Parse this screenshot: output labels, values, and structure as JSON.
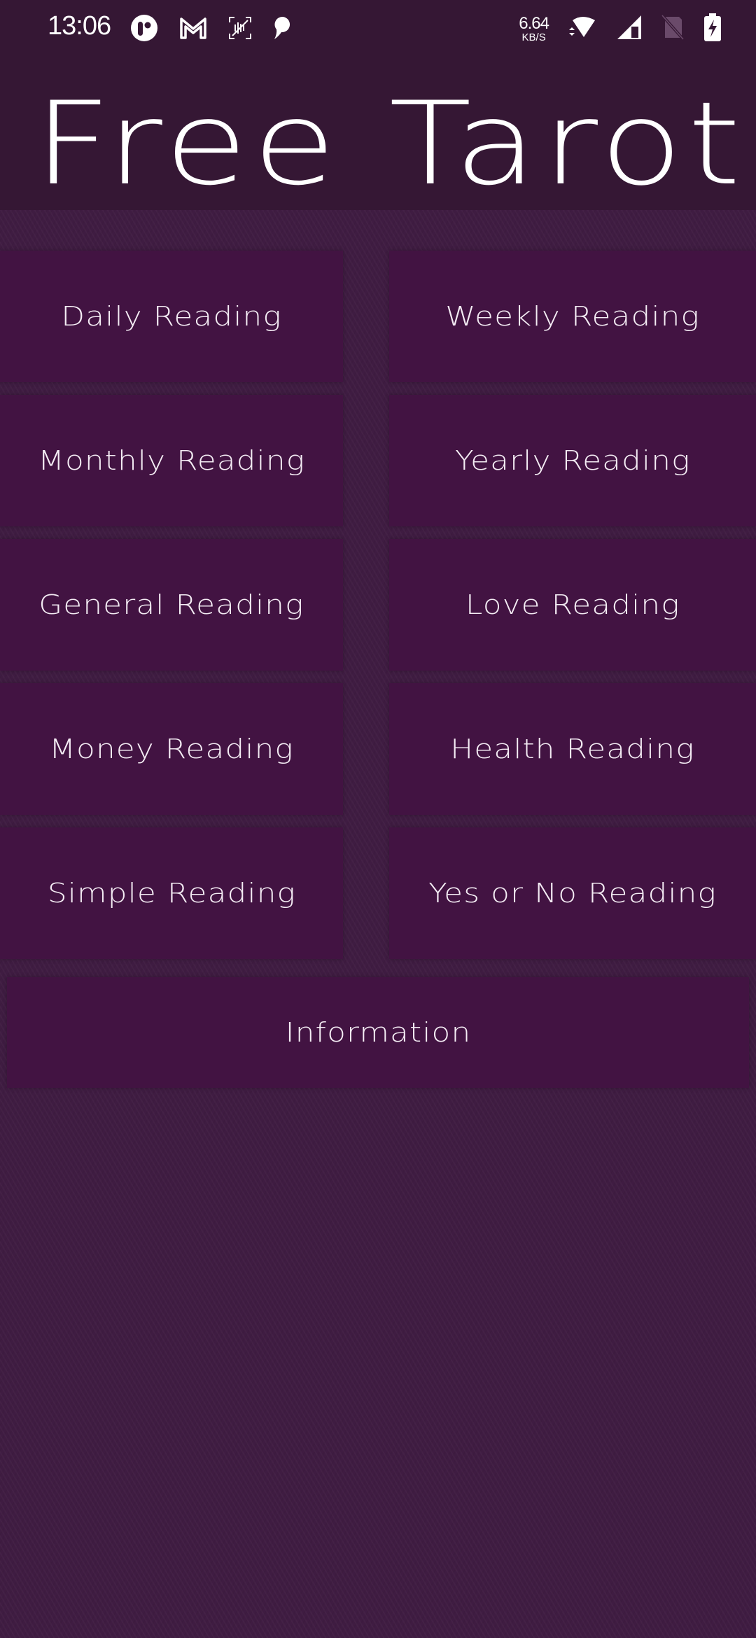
{
  "status_bar": {
    "time": "13:06",
    "notification_icons": [
      "app-notification-icon",
      "gmail-icon",
      "voice-recorder-icon",
      "chat-bubble-icon"
    ],
    "net_speed_value": "6.64",
    "net_speed_unit": "KB/S",
    "system_icons": [
      "wifi-icon",
      "cellular-signal-icon",
      "no-sim-icon",
      "battery-charging-icon"
    ]
  },
  "header": {
    "title": "Free Tarot"
  },
  "menu": {
    "buttons": [
      {
        "label": "Daily Reading"
      },
      {
        "label": "Weekly Reading"
      },
      {
        "label": "Monthly Reading"
      },
      {
        "label": "Yearly Reading"
      },
      {
        "label": "General Reading"
      },
      {
        "label": "Love Reading"
      },
      {
        "label": "Money Reading"
      },
      {
        "label": "Health Reading"
      },
      {
        "label": "Simple Reading"
      },
      {
        "label": "Yes or No Reading"
      }
    ],
    "information_label": "Information"
  },
  "colors": {
    "background": "#3f1c42",
    "header": "#351734",
    "button": "#421342",
    "text": "#ffffff"
  }
}
